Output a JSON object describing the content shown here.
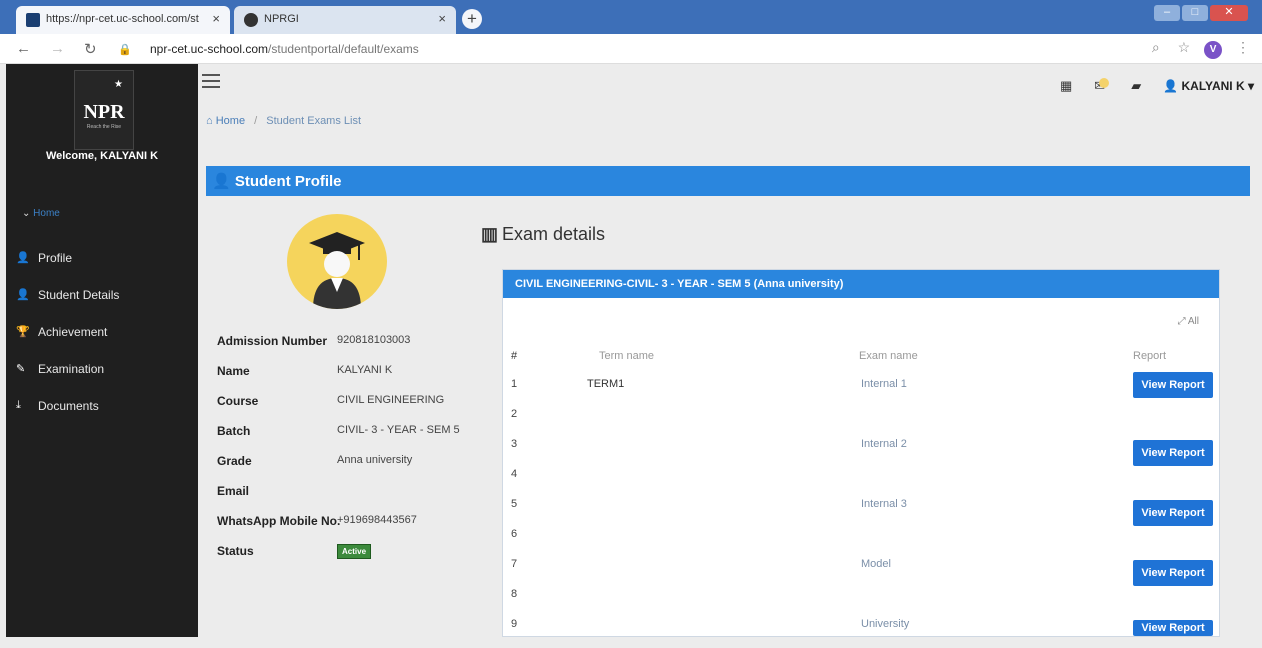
{
  "browser": {
    "tabs": [
      {
        "title": "https://npr-cet.uc-school.com/st",
        "close": "×"
      },
      {
        "title": "NPRGI",
        "close": "×"
      }
    ],
    "new_tab": "+",
    "url_host": "npr-cet.uc-school.com",
    "url_path": "/studentportal/default/exams",
    "profile_initial": "V"
  },
  "sidebar": {
    "logo_text": "NPR",
    "logo_tagline": "Reach the Rise",
    "welcome": "Welcome, KALYANI K",
    "home_label": "Home",
    "items": [
      {
        "label": "Profile",
        "icon": "user-icon"
      },
      {
        "label": "Student Details",
        "icon": "user-icon"
      },
      {
        "label": "Achievement",
        "icon": "trophy-icon"
      },
      {
        "label": "Examination",
        "icon": "pencil-icon"
      },
      {
        "label": "Documents",
        "icon": "download-icon"
      }
    ]
  },
  "topbar": {
    "user_name": "KALYANI K"
  },
  "breadcrumb": {
    "home": "Home",
    "current": "Student Exams List"
  },
  "profile": {
    "section_title": "Student Profile",
    "fields": [
      {
        "label": "Admission Number",
        "value": "920818103003"
      },
      {
        "label": "Name",
        "value": "KALYANI K"
      },
      {
        "label": "Course",
        "value": "CIVIL ENGINEERING"
      },
      {
        "label": "Batch",
        "value": "CIVIL- 3 - YEAR - SEM 5"
      },
      {
        "label": "Grade",
        "value": "Anna university"
      },
      {
        "label": "Email",
        "value": ""
      },
      {
        "label": "WhatsApp Mobile No.",
        "value": "+919698443567"
      },
      {
        "label": "Status",
        "value": "Active"
      }
    ]
  },
  "exams": {
    "title": "Exam details",
    "panel_title": "CIVIL ENGINEERING-CIVIL- 3 - YEAR - SEM 5 (Anna university)",
    "all_label": "All",
    "columns": {
      "num": "#",
      "term": "Term name",
      "exam": "Exam name",
      "report": "Report"
    },
    "view_label": "View Report",
    "rows": [
      {
        "num": "1",
        "term": "TERM1",
        "exam": "Internal 1",
        "has_button": true
      },
      {
        "num": "2",
        "term": "",
        "exam": "",
        "has_button": false
      },
      {
        "num": "3",
        "term": "",
        "exam": "Internal 2",
        "has_button": true
      },
      {
        "num": "4",
        "term": "",
        "exam": "",
        "has_button": false
      },
      {
        "num": "5",
        "term": "",
        "exam": "Internal 3",
        "has_button": true
      },
      {
        "num": "6",
        "term": "",
        "exam": "",
        "has_button": false
      },
      {
        "num": "7",
        "term": "",
        "exam": "Model",
        "has_button": true
      },
      {
        "num": "8",
        "term": "",
        "exam": "",
        "has_button": false
      },
      {
        "num": "9",
        "term": "",
        "exam": "University",
        "has_button": true
      }
    ]
  },
  "colors": {
    "accent": "#2a86de",
    "sidebar_bg": "#1f1f1f",
    "button": "#1f73d6",
    "status_active": "#3c8a3c"
  }
}
